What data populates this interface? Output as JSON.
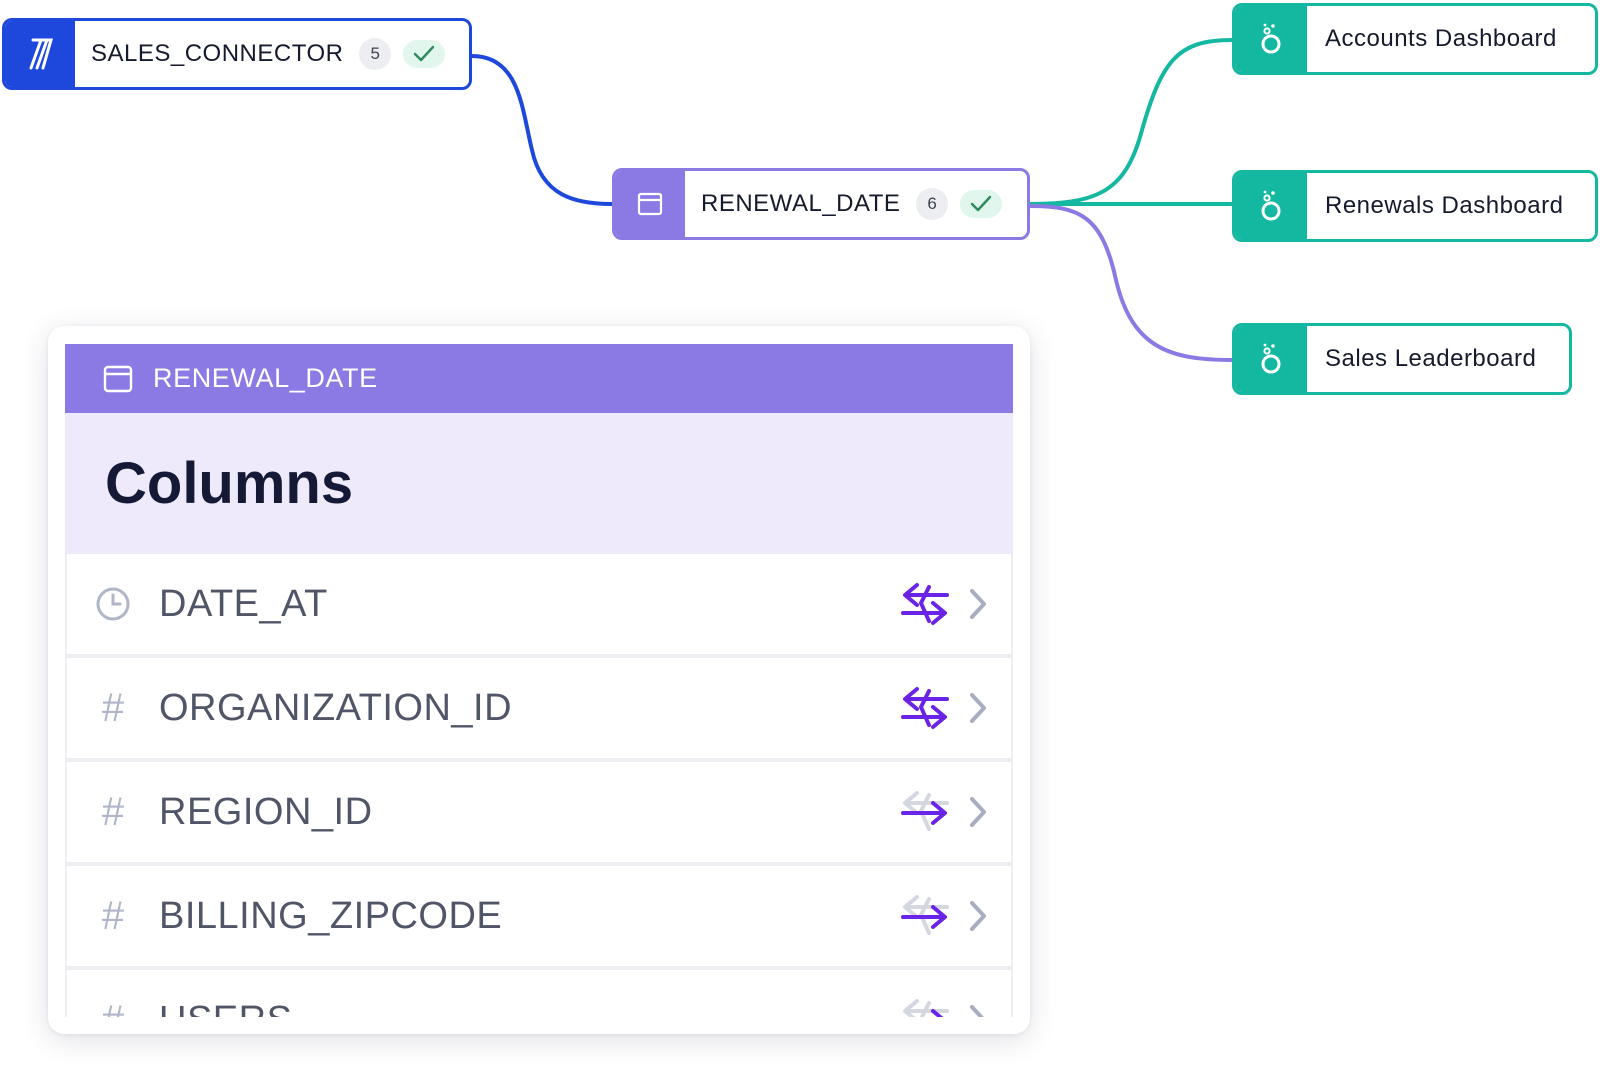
{
  "nodes": {
    "sales_connector": {
      "label": "SALES_CONNECTOR",
      "count": "5",
      "icon": "connector-icon"
    },
    "renewal_date": {
      "label": "RENEWAL_DATE",
      "count": "6",
      "icon": "table-icon"
    }
  },
  "dashboards": [
    {
      "label": "Accounts Dashboard",
      "icon": "dashboard-logo-icon"
    },
    {
      "label": "Renewals Dashboard",
      "icon": "dashboard-logo-icon"
    },
    {
      "label": "Sales Leaderboard",
      "icon": "dashboard-logo-icon"
    }
  ],
  "panel": {
    "header_title": "RENEWAL_DATE",
    "section_title": "Columns",
    "columns": [
      {
        "name": "DATE_AT",
        "type_icon": "clock-icon",
        "type_glyph": ""
      },
      {
        "name": "ORGANIZATION_ID",
        "type_icon": "hash-icon",
        "type_glyph": "#"
      },
      {
        "name": "REGION_ID",
        "type_icon": "hash-icon",
        "type_glyph": "#"
      },
      {
        "name": "BILLING_ZIPCODE",
        "type_icon": "hash-icon",
        "type_glyph": "#"
      },
      {
        "name": "USERS",
        "type_icon": "hash-icon",
        "type_glyph": "#"
      }
    ]
  },
  "colors": {
    "connector": "#1e48dc",
    "table": "#8b7ae4",
    "dashboard": "#14b8a0",
    "lineage": "#6a24e8",
    "lineage_dim": "#d4d6e0"
  }
}
